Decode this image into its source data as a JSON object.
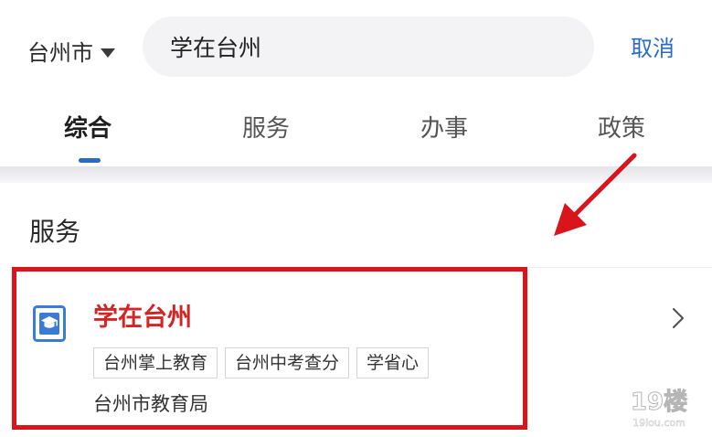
{
  "header": {
    "city_label": "台州市",
    "search_value": "学在台州",
    "cancel_label": "取消"
  },
  "tabs": [
    {
      "label": "综合",
      "active": true
    },
    {
      "label": "服务",
      "active": false
    },
    {
      "label": "办事",
      "active": false
    },
    {
      "label": "政策",
      "active": false
    }
  ],
  "section": {
    "title": "服务"
  },
  "result": {
    "name": "学在台州",
    "tags": [
      "台州掌上教育",
      "台州中考查分",
      "学省心"
    ],
    "provider": "台州市教育局",
    "highlighted": true
  },
  "icons": {
    "city_dropdown": "caret-down-icon",
    "app": "graduation-cap-app-icon",
    "open": "chevron-right-icon"
  },
  "watermark": {
    "logo_text": "19楼",
    "domain_text": "19lou.com"
  },
  "colors": {
    "accent_blue": "#2a6bc6",
    "highlight_red": "#d9141b",
    "app_name_red": "#d42424",
    "app_icon_blue": "#3a7bd5",
    "search_bg": "#f3f3f5"
  }
}
